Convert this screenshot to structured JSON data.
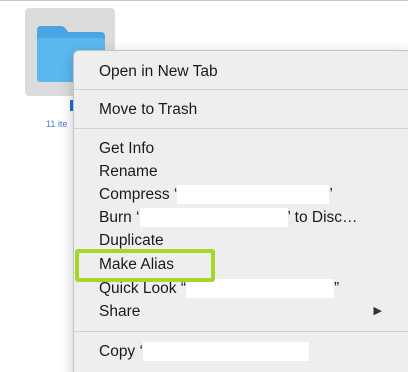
{
  "folder": {
    "caption": "11 ite"
  },
  "menu": {
    "open_new_tab": "Open in New Tab",
    "move_to_trash": "Move to Trash",
    "get_info": "Get Info",
    "rename": "Rename",
    "compress_prefix": "Compress ‘",
    "compress_suffix": "’",
    "burn_prefix": "Burn ‘",
    "burn_suffix": "’ to Disc…",
    "duplicate": "Duplicate",
    "make_alias": "Make Alias",
    "quick_look_prefix": "Quick Look “",
    "quick_look_suffix": "”",
    "share": "Share",
    "copy_prefix": "Copy ‘"
  },
  "colors": {
    "highlight": "#a5d62a",
    "folder_blue": "#5bb8ef",
    "menu_bg": "#eeeeee"
  },
  "icons": {
    "folder": "folder-icon",
    "submenu": "submenu-arrow-icon"
  }
}
